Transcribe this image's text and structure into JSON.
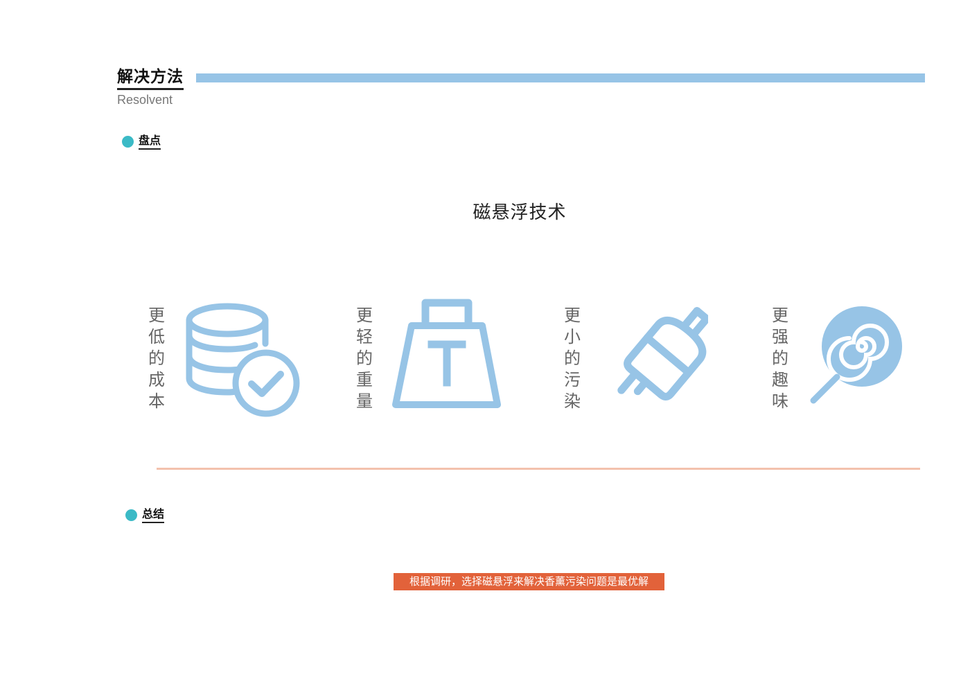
{
  "header": {
    "title": "解决方法",
    "subtitle": "Resolvent"
  },
  "section_inventory": {
    "label": "盘点",
    "headline": "磁悬浮技术",
    "features": [
      {
        "label": "更低的成本",
        "icon": "database-check-icon"
      },
      {
        "label": "更轻的重量",
        "icon": "weight-icon"
      },
      {
        "label": "更小的污染",
        "icon": "broom-icon"
      },
      {
        "label": "更强的趣味",
        "icon": "lollipop-icon"
      }
    ]
  },
  "section_summary": {
    "label": "总结",
    "conclusion": "根据调研，选择磁悬浮来解决香薰污染问题是最优解"
  },
  "colors": {
    "accent_blue": "#97c4e6",
    "dot_teal": "#3bbac6",
    "divider_peach": "#f3c1ad",
    "highlight_orange": "#e2623a"
  }
}
